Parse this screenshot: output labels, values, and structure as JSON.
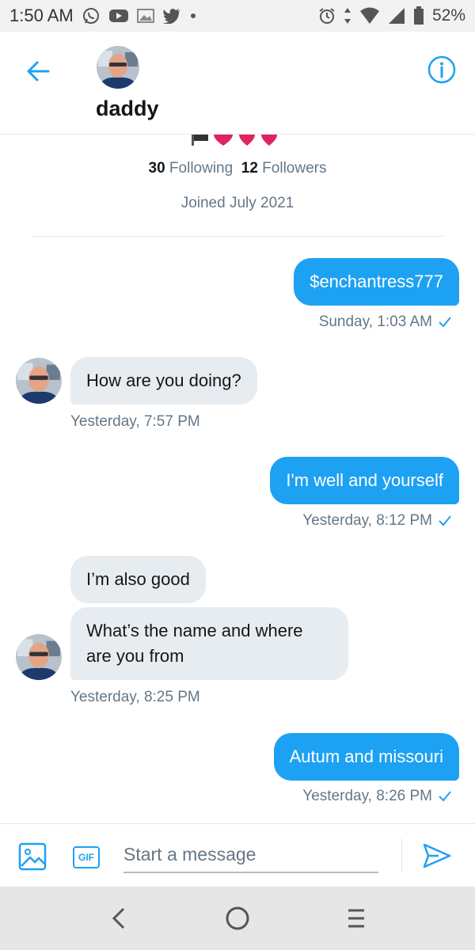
{
  "status_bar": {
    "time": "1:50 AM",
    "battery": "52%",
    "icons_left": [
      "whatsapp-icon",
      "youtube-icon",
      "gallery-icon",
      "twitter-icon",
      "dot-icon"
    ],
    "icons_right": [
      "alarm-icon",
      "data-arrows-icon",
      "wifi-icon",
      "signal-icon",
      "battery-icon"
    ]
  },
  "header": {
    "name": "daddy",
    "back_icon": "arrow-left-icon",
    "info_icon": "info-icon"
  },
  "profile": {
    "following_count": "30",
    "following_label": "Following",
    "followers_count": "12",
    "followers_label": "Followers",
    "joined": "Joined July 2021"
  },
  "messages": [
    {
      "direction": "out",
      "text": "$enchantress777",
      "time": "Sunday, 1:03 AM"
    },
    {
      "direction": "in",
      "text": "How are you doing?",
      "time": "Yesterday, 7:57 PM"
    },
    {
      "direction": "out",
      "text": "I'm well and yourself",
      "time": "Yesterday, 8:12 PM"
    },
    {
      "direction": "in",
      "text": "I’m also good"
    },
    {
      "direction": "in",
      "text": "What’s the name and where are you from",
      "time": "Yesterday, 8:25 PM"
    },
    {
      "direction": "out",
      "text": "Autum and missouri",
      "time": "Yesterday, 8:26 PM"
    }
  ],
  "composer": {
    "placeholder": "Start a message",
    "gif_label": "GIF",
    "media_icon": "image-icon",
    "send_icon": "send-icon"
  },
  "colors": {
    "accent": "#1da1f2",
    "bubble_in": "#e6ecf0",
    "meta_text": "#657786",
    "heart": "#e0245e"
  }
}
